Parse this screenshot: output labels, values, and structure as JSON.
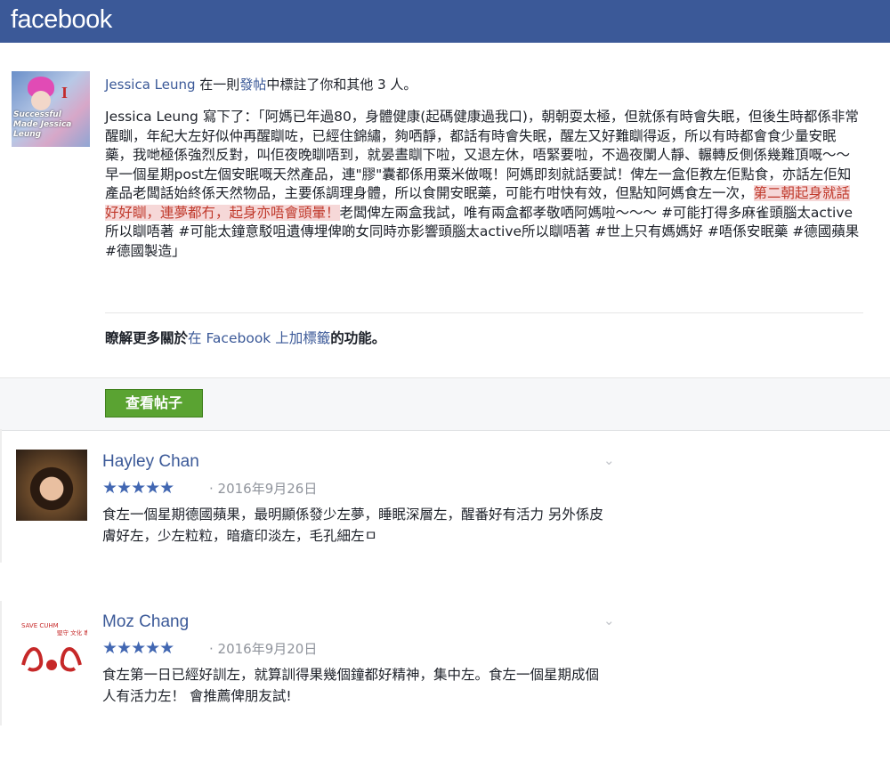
{
  "app": {
    "logo": "facebook"
  },
  "notification": {
    "user": "Jessica Leung",
    "text_a": "在一則",
    "post_link": "發帖",
    "text_b": "中標註了你和其他 3 人。",
    "post_prefix": "Jessica Leung 寫下了：",
    "post_body_1": "「阿媽已年過80，身體健康(起碼健康過我口)，朝朝耍太極，但就係有時會失眠，但後生時都係非常醒瞓，年紀大左好似仲再醒瞓咗，已經住錦繡，夠哂靜，都話有時會失眠，醒左又好難瞓得返，所以有時都會食少量安眠藥，我哋極係強烈反對，叫佢夜晚瞓唔到，就晏晝瞓下啦，又退左休，唔緊要啦，不過夜闌人靜、輾轉反側係幾難頂嘅～～ 早一個星期post左個安眠嘅天然產品，連\"膠\"囊都係用粟米做嘅！阿媽即刻就話要試！俾左一盒佢教左佢點食，亦話左佢知產品老闆話始終係天然物品，主要係調理身體，所以食開安眠藥，可能冇咁快有效，但點知阿媽食左一次，",
    "post_highlight": "第二朝起身就話好好瞓，連夢都冇，起身亦唔會頭暈！",
    "post_body_2": "老闆俾左兩盒我試，唯有兩盒都孝敬哂阿媽啦～～～ #可能打得多麻雀頭腦太active所以瞓唔著 #可能太鐘意駁咀遺傳埋俾啲女同時亦影響頭腦太active所以瞓唔著 #世上只有媽媽好 #唔係安眠藥 #德國蘋果 #德國製造」",
    "learn_prefix": "瞭解更多關於",
    "learn_link": "在 Facebook 上加標籤",
    "learn_suffix": "的功能。",
    "button": "查看帖子",
    "avatar_text": "Successful Made Jessica Leung",
    "avatar_letter": "I"
  },
  "reviews": [
    {
      "name": "Hayley Chan",
      "stars": "★★★★★",
      "rating": 5,
      "date": "· 2016年9月26日",
      "text": "食左一個星期德國蘋果，最明顯係發少左夢，睡眠深層左，醒番好有活力 另外係皮膚好左，少左粒粒，暗瘡印淡左，毛孔細左ㅁ"
    },
    {
      "name": "Moz Chang",
      "stars": "★★★★★",
      "rating": 5,
      "date": "· 2016年9月20日",
      "text": "食左第一日已經好訓左，就算訓得果幾個鐘都好精神，集中左。食左一個星期成個人有活力左！ 會推薦俾朋友試!",
      "avatar_text": "SAVE CUHM",
      "avatar_text2": "堅守 文化 專業"
    }
  ],
  "icons": {
    "chevron": "chevron-down-icon",
    "star": "star-icon"
  },
  "colors": {
    "brand": "#3b5998",
    "button": "#5aa332",
    "star": "#4267b2",
    "highlight": "#c0392b"
  }
}
